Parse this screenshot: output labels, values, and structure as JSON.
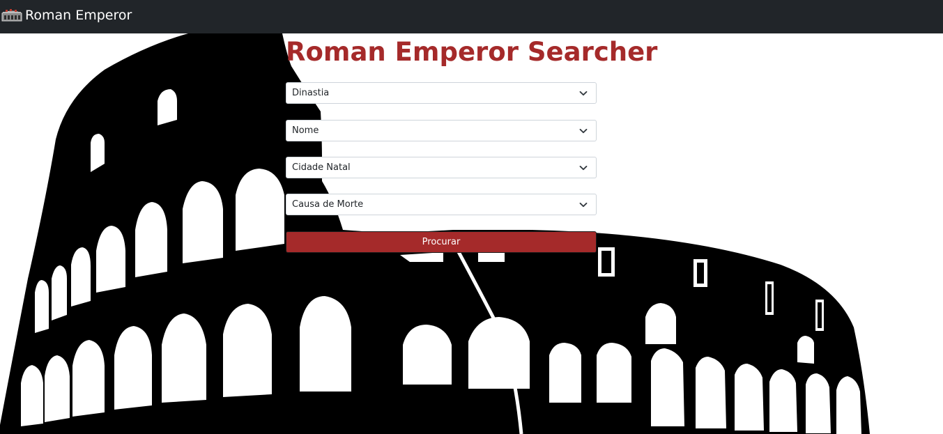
{
  "navbar": {
    "brand_label": "Roman Emperor",
    "logo_icon": "colosseum-icon",
    "background": "#212529"
  },
  "main": {
    "title": "Roman Emperor Searcher",
    "title_color": "#a52a2a",
    "filters": [
      {
        "selected": "Dinastia"
      },
      {
        "selected": "Nome"
      },
      {
        "selected": "Cidade Natal"
      },
      {
        "selected": "Causa de Morte"
      }
    ],
    "search_button_label": "Procurar",
    "search_button_color": "#a52a2a"
  },
  "background": {
    "image": "colosseum-silhouette"
  }
}
